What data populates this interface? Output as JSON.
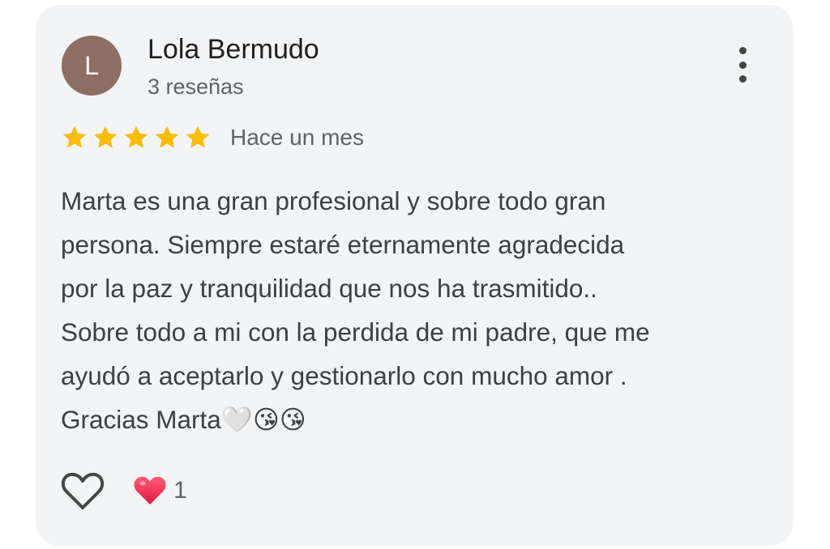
{
  "review": {
    "author": {
      "initial": "L",
      "name": "Lola Bermudo",
      "review_count": "3 reseñas",
      "avatar_color": "#8d6e63"
    },
    "menu_icon": "more-vert-icon",
    "rating": {
      "stars": 5,
      "max": 5,
      "star_color": "#fbbc04"
    },
    "date": "Hace un mes",
    "text_lines": [
      "Marta es una gran profesional y sobre todo gran",
      "persona. Siempre estaré eternamente agradecida",
      "por la paz y tranquilidad que nos ha trasmitido..",
      "Sobre todo a mi con la perdida de mi padre, que me",
      "ayudó a aceptarlo y gestionarlo con mucho amor .",
      "Gracias Marta🤍😘😘"
    ],
    "actions": {
      "like_icon": "heart-outline-icon",
      "reaction_icon": "red-heart-icon",
      "reaction_count": "1"
    }
  }
}
